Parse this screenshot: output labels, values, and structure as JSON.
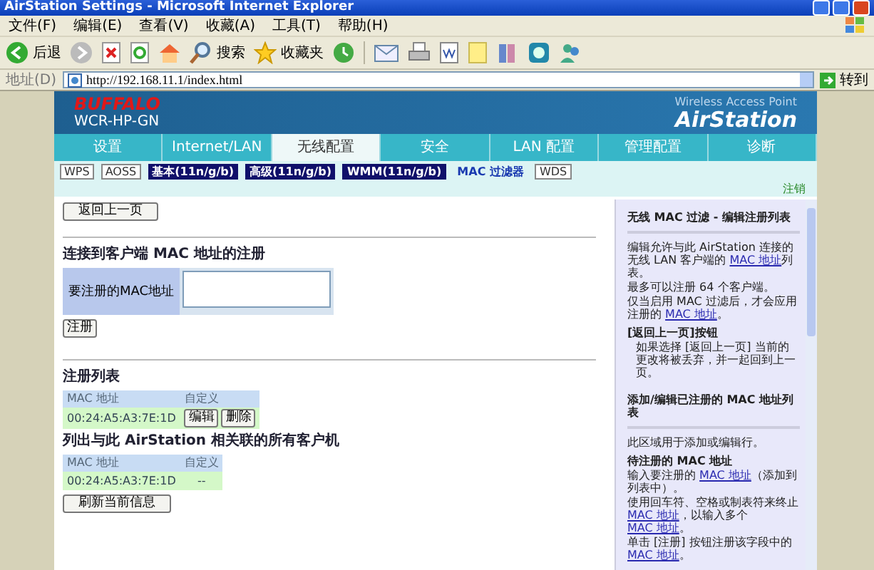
{
  "window": {
    "title": "AirStation Settings - Microsoft Internet Explorer"
  },
  "menu": [
    "文件(F)",
    "编辑(E)",
    "查看(V)",
    "收藏(A)",
    "工具(T)",
    "帮助(H)"
  ],
  "toolbar": {
    "back": "后退",
    "search": "搜索",
    "favorites": "收藏夹"
  },
  "address": {
    "label": "地址(D)",
    "url": "http://192.168.11.1/index.html",
    "go": "转到"
  },
  "header": {
    "brand": "BUFFALO",
    "model": "WCR-HP-GN",
    "tagline": "Wireless Access Point",
    "product": "AirStation"
  },
  "tabs": [
    {
      "label": "设置",
      "selected": false
    },
    {
      "label": "Internet/LAN",
      "selected": false
    },
    {
      "label": "无线配置",
      "selected": true
    },
    {
      "label": "安全",
      "selected": false
    },
    {
      "label": "LAN 配置",
      "selected": false
    },
    {
      "label": "管理配置",
      "selected": false
    },
    {
      "label": "诊断",
      "selected": false
    }
  ],
  "subtabs": [
    {
      "label": "WPS",
      "kind": "plain",
      "selected": false
    },
    {
      "label": "AOSS",
      "kind": "plain",
      "selected": false
    },
    {
      "label": "基本(11n/g/b)",
      "kind": "dark",
      "selected": false
    },
    {
      "label": "高级(11n/g/b)",
      "kind": "dark",
      "selected": false
    },
    {
      "label": "WMM(11n/g/b)",
      "kind": "dark",
      "selected": false
    },
    {
      "label": "MAC 过滤器",
      "kind": "plain",
      "selected": true
    },
    {
      "label": "WDS",
      "kind": "plain",
      "selected": false
    }
  ],
  "logout": "注销",
  "back_button": "返回上一页",
  "register_section": {
    "heading": "连接到客户端  MAC 地址的注册",
    "field_label": "要注册的MAC地址",
    "button": "注册"
  },
  "registered": {
    "heading": "注册列表",
    "columns": [
      "MAC 地址",
      "自定义"
    ],
    "rows": [
      {
        "mac": "00:24:A5:A3:7E:1D",
        "edit": "编辑",
        "delete": "删除"
      }
    ]
  },
  "associated": {
    "heading": "列出与此 AirStation 相关联的所有客户机",
    "columns": [
      "MAC 地址",
      "自定义"
    ],
    "rows": [
      {
        "mac": "00:24:A5:A3:7E:1D",
        "custom": "--"
      }
    ],
    "refresh": "刷新当前信息"
  },
  "help": [
    {
      "kind": "title",
      "parts": [
        {
          "text": "无线  MAC 过滤  -  编辑注册列表",
          "link": false
        }
      ]
    },
    {
      "kind": "text",
      "parts": [
        {
          "text": "编辑允许与此 AirStation 连接的无线 LAN 客户端的 ",
          "link": false
        },
        {
          "text": "MAC 地址",
          "link": true
        },
        {
          "text": "列表。",
          "link": false
        }
      ]
    },
    {
      "kind": "text",
      "parts": [
        {
          "text": "最多可以注册 64 个客户端。",
          "link": false
        }
      ]
    },
    {
      "kind": "text",
      "parts": [
        {
          "text": "仅当启用 MAC 过滤后，才会应用注册的 ",
          "link": false
        },
        {
          "text": "MAC 地址",
          "link": true
        },
        {
          "text": "。",
          "link": false
        }
      ]
    },
    {
      "kind": "subtitle",
      "parts": [
        {
          "text": "[返回上一页]按钮",
          "link": false
        }
      ]
    },
    {
      "kind": "note",
      "parts": [
        {
          "text": "如果选择 [返回上一页] 当前的更改将被丢弃，并一起回到上一页。",
          "link": false
        }
      ]
    },
    {
      "kind": "title",
      "parts": [
        {
          "text": "添加/编辑已注册的  MAC 地址列表",
          "link": false
        }
      ]
    },
    {
      "kind": "text",
      "parts": [
        {
          "text": "此区域用于添加或编辑行。",
          "link": false
        }
      ]
    },
    {
      "kind": "subtitle",
      "parts": [
        {
          "text": "待注册的  MAC 地址",
          "link": false
        }
      ]
    },
    {
      "kind": "text",
      "parts": [
        {
          "text": "输入要注册的 ",
          "link": false
        },
        {
          "text": "MAC 地址",
          "link": true
        },
        {
          "text": "（添加到列表中）。",
          "link": false
        }
      ]
    },
    {
      "kind": "text",
      "parts": [
        {
          "text": "使用回车符、空格或制表符来终止 ",
          "link": false
        },
        {
          "text": "MAC 地址",
          "link": true
        },
        {
          "text": "，以输入多个 ",
          "link": false
        },
        {
          "text": "MAC 地址",
          "link": true
        },
        {
          "text": "。",
          "link": false
        }
      ]
    },
    {
      "kind": "text",
      "parts": [
        {
          "text": "单击 [注册] 按钮注册该字段中的 ",
          "link": false
        },
        {
          "text": "MAC 地址",
          "link": true
        },
        {
          "text": "。",
          "link": false
        }
      ]
    }
  ]
}
